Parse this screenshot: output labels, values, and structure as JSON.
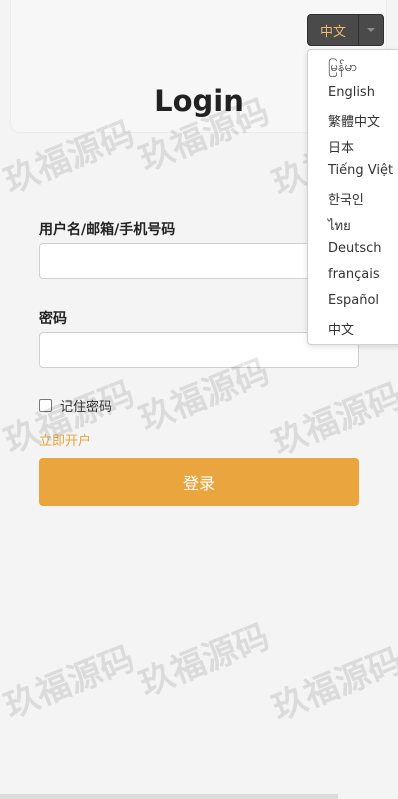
{
  "page_title": "Login",
  "language": {
    "current": "中文",
    "options": [
      "မြန်မာ",
      "English",
      "繁體中文",
      "日本",
      "Tiếng Việt",
      "한국인",
      "ไทย",
      "Deutsch",
      "français",
      "Español",
      "中文"
    ]
  },
  "form": {
    "username_label": "用户名/邮箱/手机号码",
    "password_label": "密码",
    "remember_label": "记住密码",
    "register_link": "立即开户",
    "submit_label": "登录"
  },
  "watermark": "玖福源码",
  "colors": {
    "accent": "#eaa53f",
    "link": "#e9a33b",
    "language_button_bg": "#4a4a4a"
  },
  "icons": {
    "language_caret": "caret-down-icon"
  }
}
